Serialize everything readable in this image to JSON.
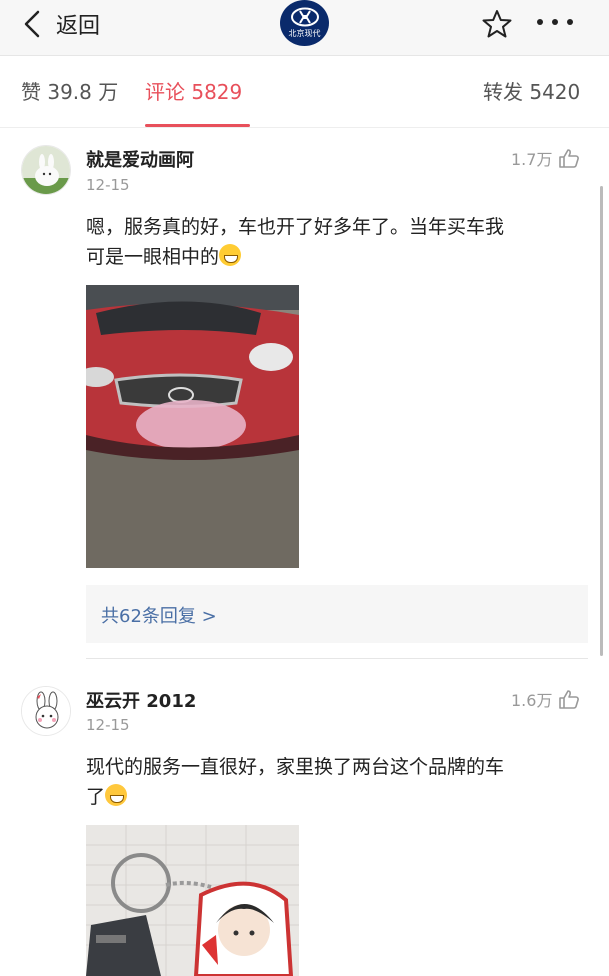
{
  "nav": {
    "back_label": "返回",
    "brand_name": "北京现代",
    "icons": [
      "chevron-left-icon",
      "hyundai-logo",
      "star-icon",
      "more-icon"
    ]
  },
  "tabs": [
    {
      "label": "赞 39.8 万",
      "active": false
    },
    {
      "label": "评论 5829",
      "active": true
    },
    {
      "label": "转发 5420",
      "active": false
    }
  ],
  "accent_color": "#e8505b",
  "link_color": "#4a6fa5",
  "comments": [
    {
      "username": "就是爱动画阿",
      "date": "12-15",
      "likes": "1.7万",
      "text_line1": "嗯，服务真的好，车也开了好多年了。当年买车我",
      "text_line2": "可是一眼相中的",
      "emoji": "grin-emoji",
      "replies_label": "共62条回复 >"
    },
    {
      "username": "巫云开 2012",
      "date": "12-15",
      "likes": "1.6万",
      "text_line1": "现代的服务一直很好，家里换了两台这个品牌的车",
      "text_line2": "了",
      "emoji": "worried-emoji"
    }
  ]
}
